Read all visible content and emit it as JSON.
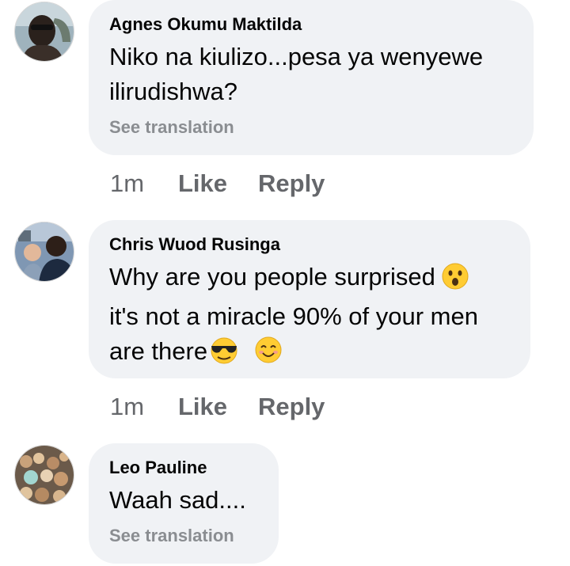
{
  "comments": [
    {
      "author": "Agnes Okumu Maktilda",
      "text": "Niko na kiulizo...pesa ya wenyewe ilirudishwa?",
      "see_translation": "See translation",
      "time": "1m",
      "like": "Like",
      "reply": "Reply"
    },
    {
      "author": "Chris Wuod Rusinga",
      "text_line1": "Why are you people surprised",
      "text_line2": "it's not a miracle 90% of your men",
      "text_line3": "are there",
      "time": "1m",
      "like": "Like",
      "reply": "Reply"
    },
    {
      "author": "Leo Pauline",
      "text": "Waah sad....",
      "see_translation": "See translation"
    }
  ],
  "icons": [
    "hushed-face-emoji",
    "sunglasses-face-emoji",
    "smiling-face-emoji"
  ],
  "colors": {
    "bubble": "#f0f2f5",
    "meta": "#65676b",
    "translation": "#8a8d91"
  }
}
